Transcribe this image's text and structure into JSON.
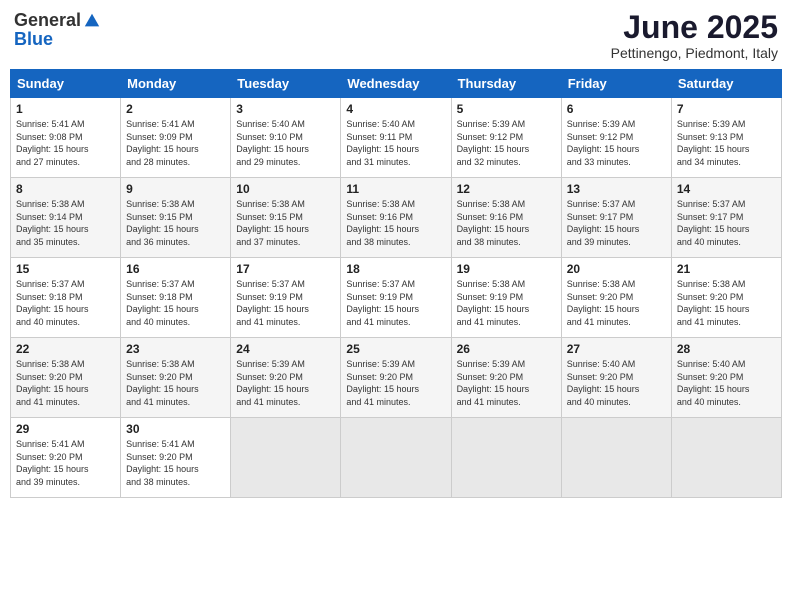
{
  "header": {
    "logo": {
      "general": "General",
      "blue": "Blue"
    },
    "title": "June 2025",
    "location": "Pettinengo, Piedmont, Italy"
  },
  "calendar": {
    "days_of_week": [
      "Sunday",
      "Monday",
      "Tuesday",
      "Wednesday",
      "Thursday",
      "Friday",
      "Saturday"
    ],
    "weeks": [
      [
        {
          "day": "",
          "info": ""
        },
        {
          "day": "2",
          "info": "Sunrise: 5:41 AM\nSunset: 9:09 PM\nDaylight: 15 hours and 28 minutes."
        },
        {
          "day": "3",
          "info": "Sunrise: 5:40 AM\nSunset: 9:10 PM\nDaylight: 15 hours and 29 minutes."
        },
        {
          "day": "4",
          "info": "Sunrise: 5:40 AM\nSunset: 9:11 PM\nDaylight: 15 hours and 31 minutes."
        },
        {
          "day": "5",
          "info": "Sunrise: 5:39 AM\nSunset: 9:12 PM\nDaylight: 15 hours and 32 minutes."
        },
        {
          "day": "6",
          "info": "Sunrise: 5:39 AM\nSunset: 9:12 PM\nDaylight: 15 hours and 33 minutes."
        },
        {
          "day": "7",
          "info": "Sunrise: 5:39 AM\nSunset: 9:13 PM\nDaylight: 15 hours and 34 minutes."
        }
      ],
      [
        {
          "day": "1",
          "info": "Sunrise: 5:41 AM\nSunset: 9:08 PM\nDaylight: 15 hours and 27 minutes."
        },
        {
          "day": "9",
          "info": "Sunrise: 5:38 AM\nSunset: 9:15 PM\nDaylight: 15 hours and 36 minutes."
        },
        {
          "day": "10",
          "info": "Sunrise: 5:38 AM\nSunset: 9:15 PM\nDaylight: 15 hours and 37 minutes."
        },
        {
          "day": "11",
          "info": "Sunrise: 5:38 AM\nSunset: 9:16 PM\nDaylight: 15 hours and 38 minutes."
        },
        {
          "day": "12",
          "info": "Sunrise: 5:38 AM\nSunset: 9:16 PM\nDaylight: 15 hours and 38 minutes."
        },
        {
          "day": "13",
          "info": "Sunrise: 5:37 AM\nSunset: 9:17 PM\nDaylight: 15 hours and 39 minutes."
        },
        {
          "day": "14",
          "info": "Sunrise: 5:37 AM\nSunset: 9:17 PM\nDaylight: 15 hours and 40 minutes."
        }
      ],
      [
        {
          "day": "8",
          "info": "Sunrise: 5:38 AM\nSunset: 9:14 PM\nDaylight: 15 hours and 35 minutes."
        },
        {
          "day": "16",
          "info": "Sunrise: 5:37 AM\nSunset: 9:18 PM\nDaylight: 15 hours and 40 minutes."
        },
        {
          "day": "17",
          "info": "Sunrise: 5:37 AM\nSunset: 9:19 PM\nDaylight: 15 hours and 41 minutes."
        },
        {
          "day": "18",
          "info": "Sunrise: 5:37 AM\nSunset: 9:19 PM\nDaylight: 15 hours and 41 minutes."
        },
        {
          "day": "19",
          "info": "Sunrise: 5:38 AM\nSunset: 9:19 PM\nDaylight: 15 hours and 41 minutes."
        },
        {
          "day": "20",
          "info": "Sunrise: 5:38 AM\nSunset: 9:20 PM\nDaylight: 15 hours and 41 minutes."
        },
        {
          "day": "21",
          "info": "Sunrise: 5:38 AM\nSunset: 9:20 PM\nDaylight: 15 hours and 41 minutes."
        }
      ],
      [
        {
          "day": "15",
          "info": "Sunrise: 5:37 AM\nSunset: 9:18 PM\nDaylight: 15 hours and 40 minutes."
        },
        {
          "day": "23",
          "info": "Sunrise: 5:38 AM\nSunset: 9:20 PM\nDaylight: 15 hours and 41 minutes."
        },
        {
          "day": "24",
          "info": "Sunrise: 5:39 AM\nSunset: 9:20 PM\nDaylight: 15 hours and 41 minutes."
        },
        {
          "day": "25",
          "info": "Sunrise: 5:39 AM\nSunset: 9:20 PM\nDaylight: 15 hours and 41 minutes."
        },
        {
          "day": "26",
          "info": "Sunrise: 5:39 AM\nSunset: 9:20 PM\nDaylight: 15 hours and 41 minutes."
        },
        {
          "day": "27",
          "info": "Sunrise: 5:40 AM\nSunset: 9:20 PM\nDaylight: 15 hours and 40 minutes."
        },
        {
          "day": "28",
          "info": "Sunrise: 5:40 AM\nSunset: 9:20 PM\nDaylight: 15 hours and 40 minutes."
        }
      ],
      [
        {
          "day": "22",
          "info": "Sunrise: 5:38 AM\nSunset: 9:20 PM\nDaylight: 15 hours and 41 minutes."
        },
        {
          "day": "30",
          "info": "Sunrise: 5:41 AM\nSunset: 9:20 PM\nDaylight: 15 hours and 38 minutes."
        },
        {
          "day": "",
          "info": ""
        },
        {
          "day": "",
          "info": ""
        },
        {
          "day": "",
          "info": ""
        },
        {
          "day": "",
          "info": ""
        },
        {
          "day": "",
          "info": ""
        }
      ],
      [
        {
          "day": "29",
          "info": "Sunrise: 5:41 AM\nSunset: 9:20 PM\nDaylight: 15 hours and 39 minutes."
        },
        {
          "day": "",
          "info": ""
        },
        {
          "day": "",
          "info": ""
        },
        {
          "day": "",
          "info": ""
        },
        {
          "day": "",
          "info": ""
        },
        {
          "day": "",
          "info": ""
        },
        {
          "day": "",
          "info": ""
        }
      ]
    ]
  }
}
